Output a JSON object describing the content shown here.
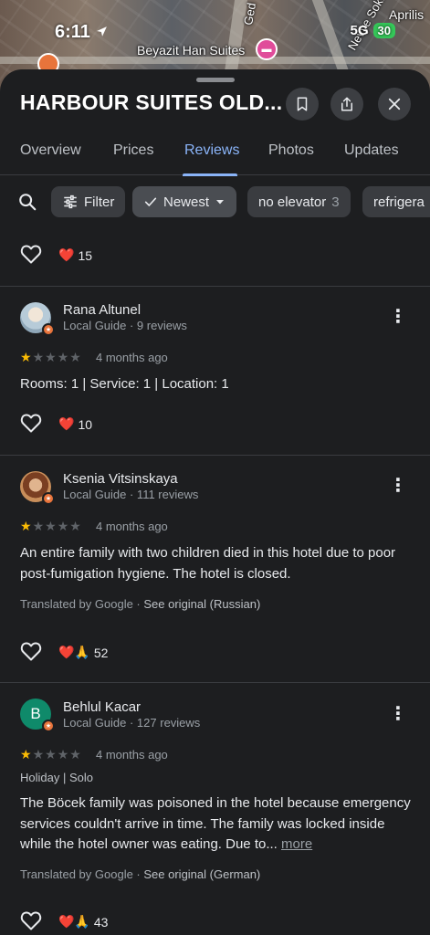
{
  "status_bar": {
    "time": "6:11",
    "network": "5G",
    "battery": "30"
  },
  "map": {
    "poi_label": "Beyazit Han Suites",
    "street_1": "Ged",
    "street_2": "Nevye Sok.",
    "street_3": "Aprilis"
  },
  "header": {
    "title": "HARBOUR SUITES OLD..."
  },
  "tabs": [
    {
      "label": "Overview"
    },
    {
      "label": "Prices"
    },
    {
      "label": "Reviews",
      "active": true
    },
    {
      "label": "Photos"
    },
    {
      "label": "Updates"
    }
  ],
  "filters": {
    "filter_label": "Filter",
    "sort_label": "Newest",
    "chip_1_label": "no elevator",
    "chip_1_count": "3",
    "chip_2_label": "refrigera"
  },
  "top_reaction": {
    "count": "15"
  },
  "reviews": [
    {
      "name": "Rana Altunel",
      "meta": "Local Guide · 9 reviews",
      "rating": 1,
      "age": "4 months ago",
      "text": "Rooms: 1 | Service: 1 | Location: 1",
      "reaction_emoji": "❤️",
      "reaction_count": "10"
    },
    {
      "name": "Ksenia Vitsinskaya",
      "meta": "Local Guide · 111 reviews",
      "rating": 1,
      "age": "4 months ago",
      "text": "An entire family with two children died in this hotel due to poor post-fumigation hygiene. The hotel is closed.",
      "translated_prefix": "Translated by Google · ",
      "translated_original": "See original (Russian)",
      "reaction_emoji": "❤️🙏",
      "reaction_count": "52"
    },
    {
      "name": "Behlul Kacar",
      "avatar_initial": "B",
      "meta": "Local Guide · 127 reviews",
      "rating": 1,
      "age": "4 months ago",
      "tags": "Holiday  |  Solo",
      "text": "The Böcek family was poisoned in the hotel because emergency services couldn't arrive in time. The family was locked inside while the hotel owner was eating. Due to...",
      "more_label": "more",
      "translated_prefix": "Translated by Google · ",
      "translated_original": "See original (German)",
      "reaction_emoji": "❤️🙏",
      "reaction_count": "43"
    }
  ],
  "colors": {
    "accent": "#8ab4f8",
    "star": "#fbbc04",
    "guide_badge": "#e8743b",
    "avatar_b": "#0f8a6a"
  }
}
